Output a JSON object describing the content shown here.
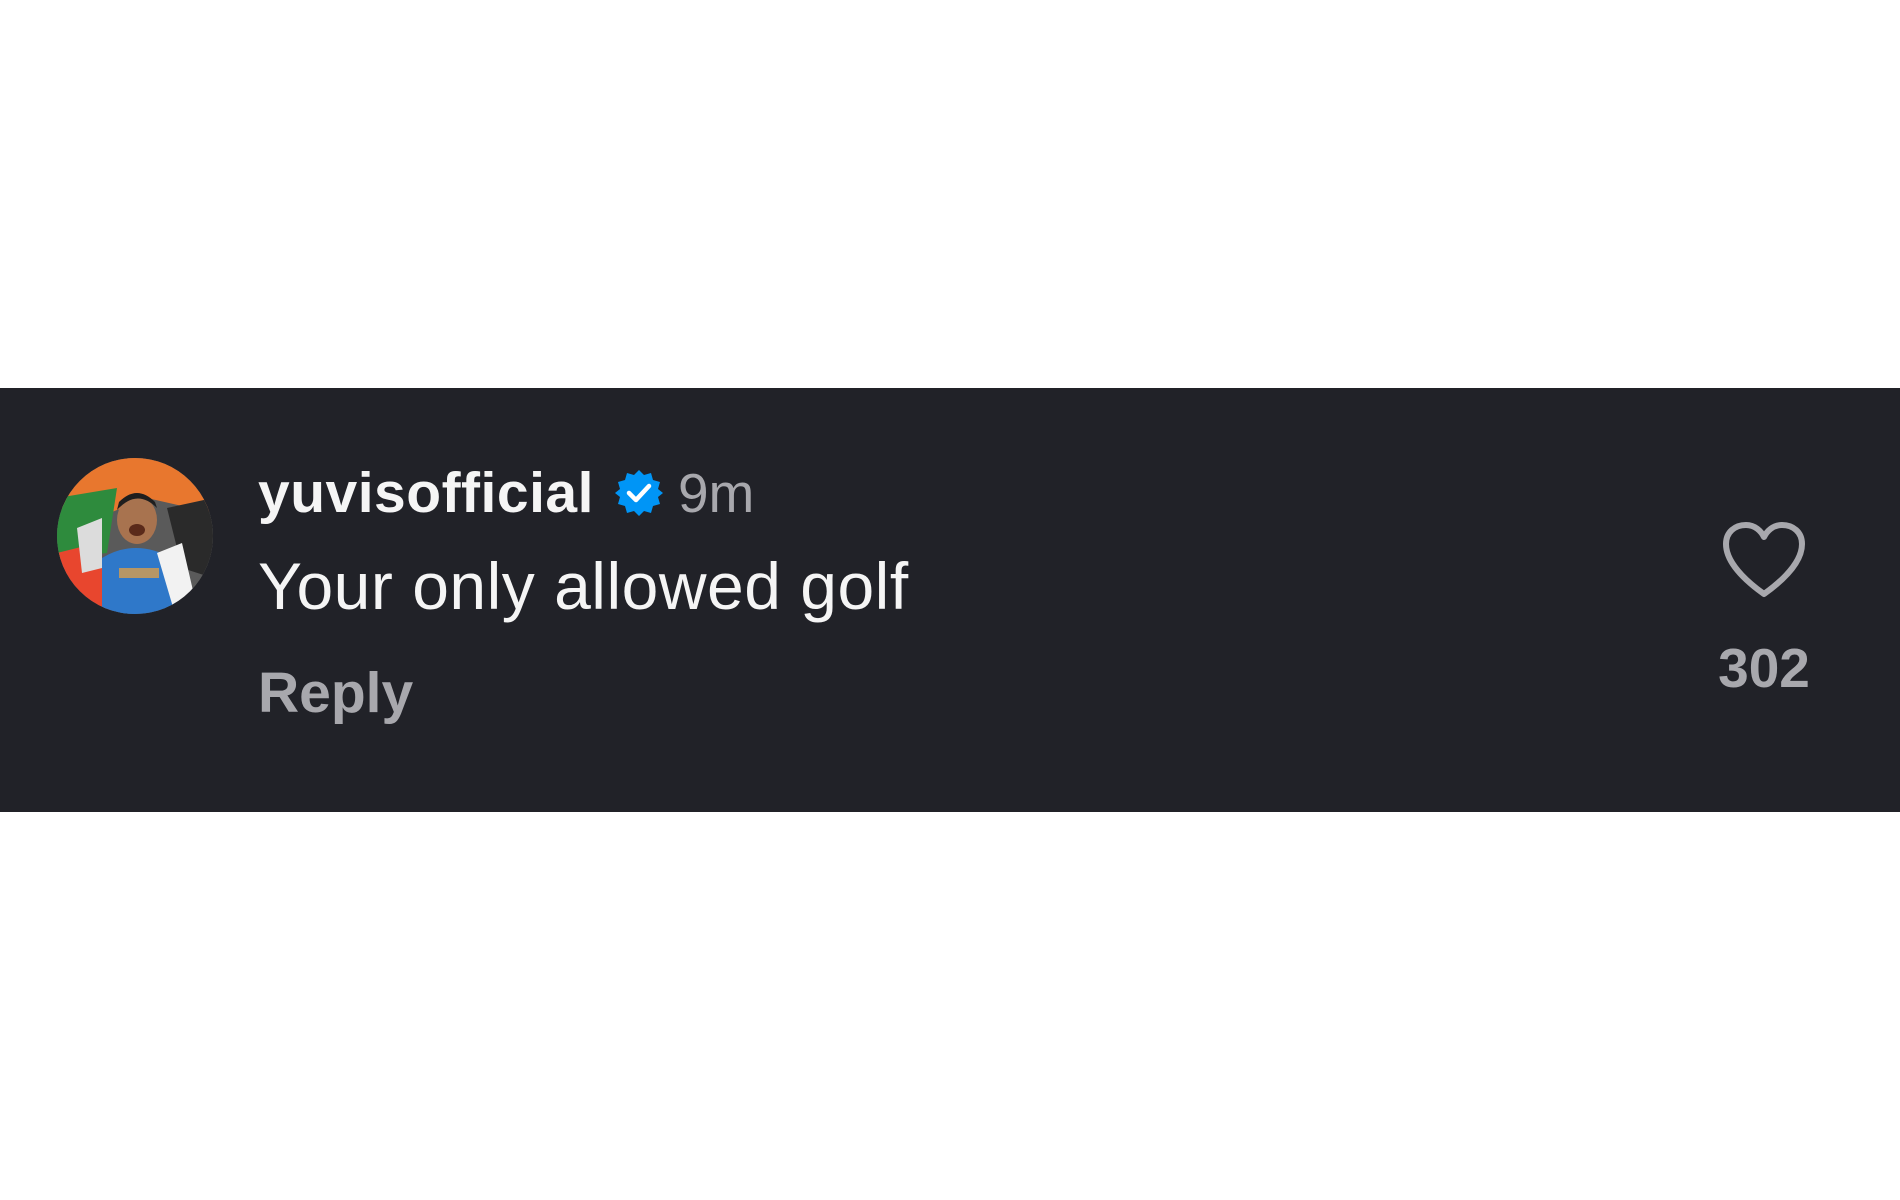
{
  "comment": {
    "username": "yuvisofficial",
    "verified_icon": "verified-badge-icon",
    "timestamp": "9m",
    "text": "Your only allowed golf",
    "reply_label": "Reply",
    "like_icon": "heart-outline-icon",
    "like_count": "302"
  },
  "colors": {
    "band_background": "#212228",
    "page_background": "#ffffff",
    "primary_text": "#f5f5f5",
    "secondary_text": "#a8a8ad",
    "verified_blue": "#0095f6"
  }
}
